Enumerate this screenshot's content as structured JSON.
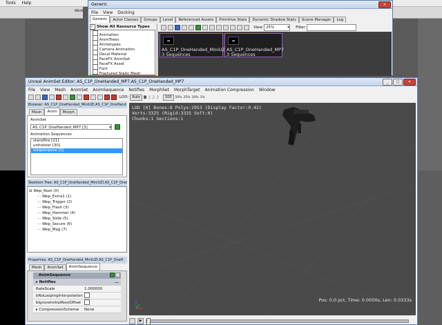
{
  "background": {
    "menu": [
      "Tools",
      "Help"
    ],
    "toolbar_label": "Work",
    "left_label": "Gen",
    "right_label": "Perspective"
  },
  "generic_browser": {
    "title": "Generic",
    "menu": [
      "File",
      "View",
      "Docking"
    ],
    "tabs": [
      "Generic",
      "Actor Classes",
      "Groups",
      "Level",
      "Referenced Assets",
      "Primitive Stats",
      "Dynamic Shadow Stats",
      "Scene Manager",
      "Log"
    ],
    "active_tab": "Generic",
    "show_all_label": "Show All Resource Types",
    "resource_types": [
      "Animation",
      "AnimTrees",
      "Archetypes",
      "Camera Animation",
      "Decal Material",
      "FaceFX AnimSet",
      "FaceFX Asset",
      "Font",
      "Fractured Static Mesh"
    ],
    "view_label": "View",
    "zoom": "25%",
    "filter_label": "Filter",
    "assets": [
      {
        "name": "AS_C1P_OneHanded_MiniUZI",
        "sub": "3 Sequences"
      },
      {
        "name": "AS_C1P_OneHanded_MP7",
        "sub": "3 Sequences"
      }
    ]
  },
  "editor": {
    "title": "Unreal AnimSet Editor: AS_C1P_OneHanded_MP7.AS_C1P_OneHanded_MP7",
    "menu": [
      "File",
      "View",
      "Mesh",
      "AnimSet",
      "AnimSequence",
      "Notifies",
      "MorphSet",
      "MorphTarget",
      "Animation Compression",
      "Window"
    ],
    "lod_label": "LOD:",
    "lod_buttons": [
      "Auto",
      "B",
      "1",
      "2",
      "3"
    ],
    "speed_buttons": [
      "100",
      "50%",
      "25%",
      "10%",
      "1%"
    ],
    "browser_title": "Browser: AS_C1P_OneHanded_MiniUZI.AS_C1P_OneHand",
    "browser_tabs": [
      "Mesh",
      "Anim",
      "Morph"
    ],
    "browser_active_tab": "Anim",
    "animset_label": "AnimSet",
    "animset_value": "AS_C1P_OneHanded_MP7 [3]",
    "anim_seq_label": "Animation Sequences",
    "sequences": [
      "standfire [21]",
      "unholster [30]",
      "weaponpose [1]"
    ],
    "selected_sequence": 2,
    "skeleton_title": "Skeleton Tree: AS_C1P_OneHanded_MiniUZI.AS_C1P_OneHand",
    "bones": [
      "Wep_Root (0)",
      "Wep_Extra1 (1)",
      "Wep_Trigger (2)",
      "Wep_Flash (3)",
      "Wep_Hammer (4)",
      "Wep_Slide (5)",
      "Wep_Secure (6)",
      "Wep_Mag (7)"
    ],
    "props_title": "Properties: AS_C1P_OneHanded_MiniUZI.AS_C1P_OneH",
    "props_tabs": [
      "Mesh",
      "AnimSet",
      "AnimSequence"
    ],
    "props_active_tab": "AnimSequence",
    "props_header": "AnimSequence",
    "props": [
      {
        "key": "Notifies",
        "value": "..."
      },
      {
        "key": "RateScale",
        "value": "1.000000"
      },
      {
        "key": "bNoLoopingInterpolation",
        "value": ""
      },
      {
        "key": "bIgnoreInitialRootOffset",
        "value": ""
      },
      {
        "key": "CompressionScheme",
        "value": "None"
      }
    ],
    "viewport_info": [
      "LOD [0] Bones:8 Polys:2953 (Display Factor:0.42)",
      "Verts:3325 (Rigid:3325 Soft:0)",
      "Chunks:1 Sections:1"
    ],
    "status": "Pos: 0.0 pct, Time: 0.0000s, Len: 0.0333s"
  },
  "colors": {
    "selection": "#3399ff",
    "asset_border": "#9b5fc0",
    "viewport": "#4a4a4a"
  }
}
